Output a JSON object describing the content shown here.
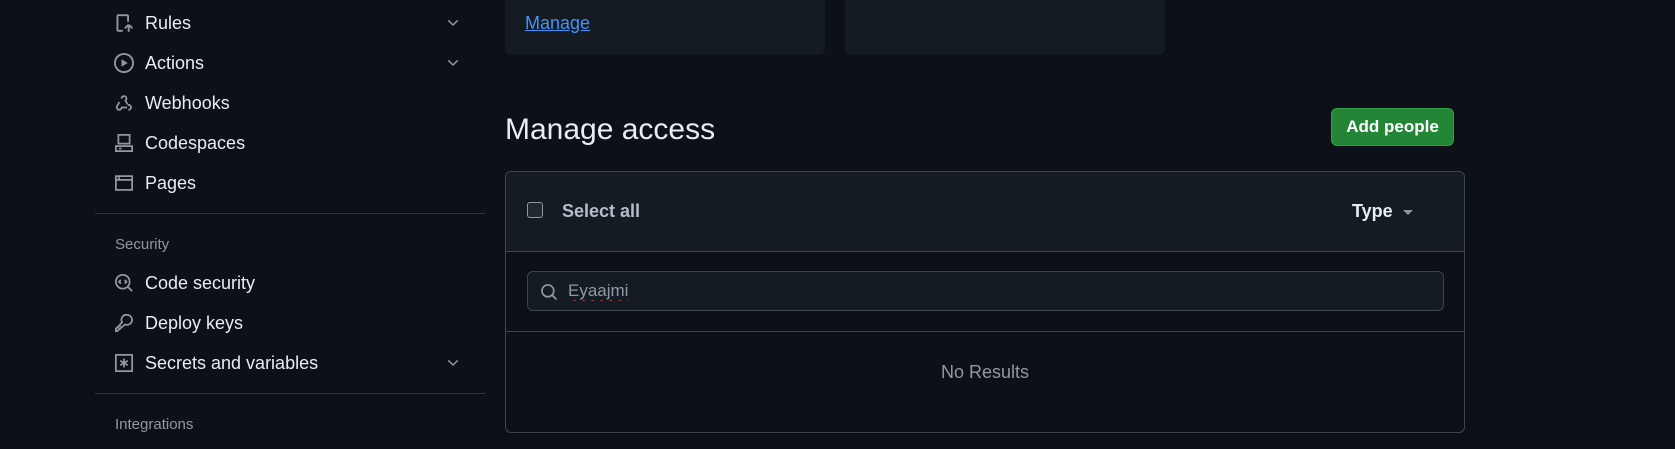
{
  "sidebar": {
    "items": [
      {
        "label": "Rules",
        "icon": "rules-icon",
        "has_chevron": true
      },
      {
        "label": "Actions",
        "icon": "play-icon",
        "has_chevron": true
      },
      {
        "label": "Webhooks",
        "icon": "webhook-icon",
        "has_chevron": false
      },
      {
        "label": "Codespaces",
        "icon": "codespaces-icon",
        "has_chevron": false
      },
      {
        "label": "Pages",
        "icon": "browser-icon",
        "has_chevron": false
      }
    ],
    "security_title": "Security",
    "security_items": [
      {
        "label": "Code security",
        "icon": "codescan-icon",
        "has_chevron": false
      },
      {
        "label": "Deploy keys",
        "icon": "key-icon",
        "has_chevron": false
      },
      {
        "label": "Secrets and variables",
        "icon": "asterisk-icon",
        "has_chevron": true
      }
    ],
    "integrations_title": "Integrations"
  },
  "cards": {
    "manage_link": "Manage"
  },
  "main": {
    "title": "Manage access",
    "add_button": "Add people",
    "select_all": "Select all",
    "type_filter": "Type",
    "search_value": "Eyaajmi",
    "no_results": "No Results"
  },
  "colors": {
    "background": "#0d1117",
    "accent_green": "#238636",
    "link_blue": "#4493f8",
    "border": "#3d444d"
  }
}
